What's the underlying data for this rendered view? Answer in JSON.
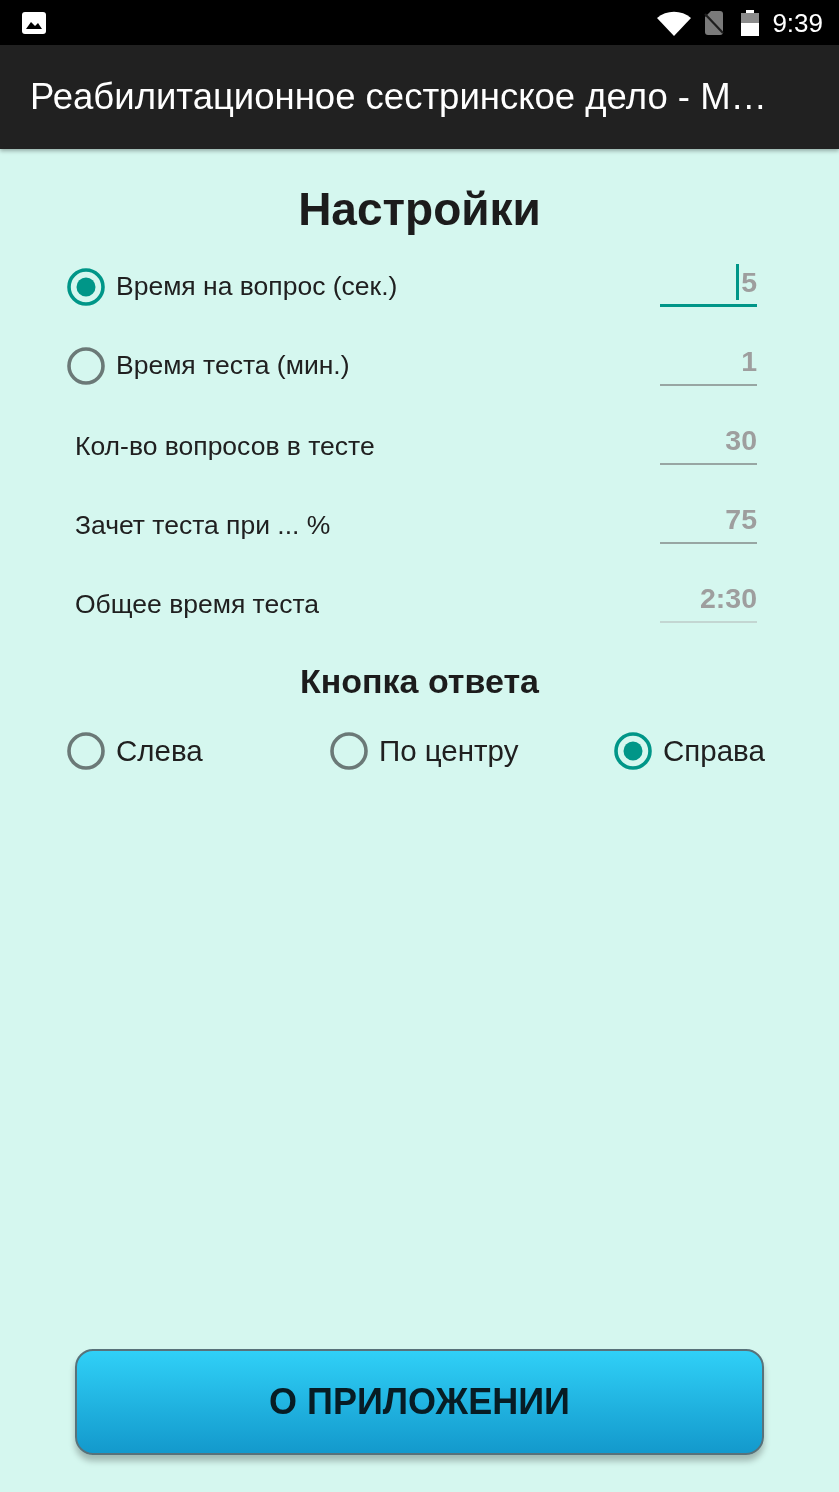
{
  "status_bar": {
    "time": "9:39"
  },
  "app_bar": {
    "title": "Реабилитационное сестринское дело - М…"
  },
  "settings": {
    "heading": "Настройки",
    "rows": [
      {
        "kind": "radio",
        "label": "Время на вопрос (сек.)",
        "selected": true,
        "field": {
          "placeholder": "5",
          "focused": true,
          "disabled": false
        }
      },
      {
        "kind": "radio",
        "label": "Время теста (мин.)",
        "selected": false,
        "field": {
          "placeholder": "1",
          "focused": false,
          "disabled": false
        }
      },
      {
        "kind": "text",
        "label": "Кол-во вопросов в тесте",
        "field": {
          "placeholder": "30",
          "focused": false,
          "disabled": false
        }
      },
      {
        "kind": "text",
        "label": "Зачет теста при ... %",
        "field": {
          "placeholder": "75",
          "focused": false,
          "disabled": false
        }
      },
      {
        "kind": "text",
        "label": "Общее время теста",
        "field": {
          "placeholder": "2:30",
          "focused": false,
          "disabled": true
        }
      }
    ]
  },
  "answer_button": {
    "heading": "Кнопка ответа",
    "options": [
      {
        "label": "Слева",
        "selected": false
      },
      {
        "label": "По центру",
        "selected": false
      },
      {
        "label": "Справа",
        "selected": true
      }
    ]
  },
  "about_button": {
    "label": "О ПРИЛОЖЕНИИ"
  }
}
